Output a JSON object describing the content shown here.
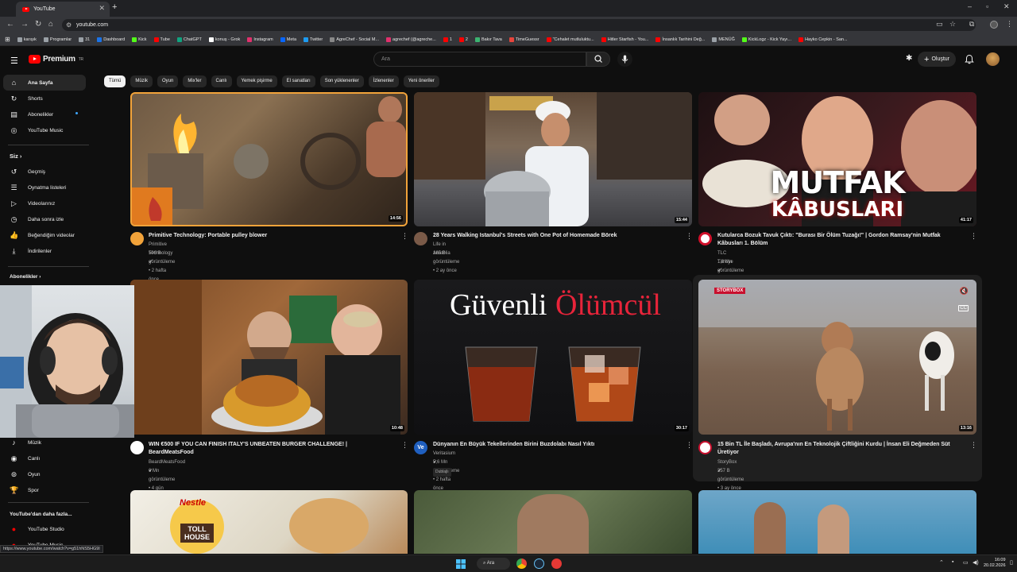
{
  "browser": {
    "tab_title": "YouTube",
    "url": "youtube.com",
    "bookmarks": [
      {
        "label": "karışık",
        "color": "#9aa0a6"
      },
      {
        "label": "Programlar",
        "color": "#9aa0a6"
      },
      {
        "label": "31",
        "color": "#9aa0a6"
      },
      {
        "label": "Dashboard",
        "color": "#1a73e8"
      },
      {
        "label": "Kick",
        "color": "#53fc18"
      },
      {
        "label": "Tube",
        "color": "#ff0000"
      },
      {
        "label": "ChatGPT",
        "color": "#10a37f"
      },
      {
        "label": "konuş - Grok",
        "color": "#ffffff"
      },
      {
        "label": "Instagram",
        "color": "#e1306c"
      },
      {
        "label": "Meta",
        "color": "#0866ff"
      },
      {
        "label": "Twitter",
        "color": "#1d9bf0"
      },
      {
        "label": "AgreChef - Social M...",
        "color": "#888888"
      },
      {
        "label": "agrechef (@agreche...",
        "color": "#e1306c"
      },
      {
        "label": "1",
        "color": "#ff0000"
      },
      {
        "label": "2",
        "color": "#ff0000"
      },
      {
        "label": "Bakır Tava",
        "color": "#3cb371"
      },
      {
        "label": "TimeGuessr",
        "color": "#e8453c"
      },
      {
        "label": "\"Cehalet mutluluktu...",
        "color": "#ff0000"
      },
      {
        "label": "Hitler Starfish - You...",
        "color": "#ff0000"
      },
      {
        "label": "İnsanlık Tarihini Değ...",
        "color": "#ff0000"
      },
      {
        "label": "MENÜĞ",
        "color": "#9aa0a6"
      },
      {
        "label": "KickLogz - Kick Yayı...",
        "color": "#53fc18"
      },
      {
        "label": "Hayko Cepkin - San...",
        "color": "#ff0000"
      }
    ]
  },
  "header": {
    "logo_text": "Premium",
    "logo_sup": "TR",
    "search_placeholder": "Ara",
    "create_label": "Oluştur"
  },
  "sidebar": {
    "main": [
      {
        "label": "Ana Sayfa",
        "icon": "home-icon",
        "glyph": "⌂"
      },
      {
        "label": "Shorts",
        "icon": "shorts-icon",
        "glyph": "↻"
      },
      {
        "label": "Abonelikler",
        "icon": "subscriptions-icon",
        "glyph": "▤"
      },
      {
        "label": "YouTube Music",
        "icon": "music-icon",
        "glyph": "◎"
      }
    ],
    "you_heading": "Siz",
    "you_items": [
      {
        "label": "Geçmiş",
        "icon": "history-icon",
        "glyph": "↺"
      },
      {
        "label": "Oynatma listeleri",
        "icon": "playlists-icon",
        "glyph": "☰"
      },
      {
        "label": "Videolarınız",
        "icon": "your-videos-icon",
        "glyph": "▷"
      },
      {
        "label": "Daha sonra izle",
        "icon": "watch-later-icon",
        "glyph": "◷"
      },
      {
        "label": "Beğendiğim videolar",
        "icon": "liked-icon",
        "glyph": "👍"
      },
      {
        "label": "İndirilenler",
        "icon": "downloads-icon",
        "glyph": "⤓"
      }
    ],
    "subs_heading": "Abonelikler",
    "explore_items": [
      {
        "label": "Müzik",
        "icon": "music-note-icon",
        "glyph": "♪"
      },
      {
        "label": "Canlı",
        "icon": "live-icon",
        "glyph": "◉"
      },
      {
        "label": "Oyun",
        "icon": "gaming-icon",
        "glyph": "⊚"
      },
      {
        "label": "Spor",
        "icon": "sports-icon",
        "glyph": "🏆"
      }
    ],
    "more_heading": "YouTube'dan daha fazla...",
    "more_items": [
      {
        "label": "YouTube Studio",
        "icon": "studio-icon",
        "glyph": "●"
      },
      {
        "label": "YouTube Music",
        "icon": "yt-music-icon",
        "glyph": "●"
      }
    ]
  },
  "chips": [
    "Tümü",
    "Müzik",
    "Oyun",
    "Mix'ler",
    "Canlı",
    "Yemek pişirme",
    "El sanatları",
    "Son yüklenenler",
    "İzlenenler",
    "Yeni öneriler"
  ],
  "videos": [
    {
      "title_1": "Primitive Technology: Portable pulley blower",
      "title_2": "",
      "channel": "Primitive Technology",
      "stats": "596 B görüntüleme • 2 hafta önce",
      "duration": "14:56",
      "avatar_color": "#f2a33a",
      "extra": ""
    },
    {
      "title_1": "28 Years Walking Istanbul's Streets with One Pot of Homemade Börek",
      "title_2": "",
      "channel": "Life in Anatolia",
      "stats": "165 B görüntüleme • 2 ay önce",
      "duration": "15:44",
      "avatar_color": "#7a5a48",
      "extra": ""
    },
    {
      "title_1": "Kutularca Bozuk Tavuk Çıktı: \"Burası Bir Ölüm Tuzağı!\" | Gordon Ramsay'nin Mutfak",
      "title_2": "Kâbusları 1. Bölüm",
      "channel": "TLC Türkiye",
      "stats": "1,6 Mn görüntüleme • 10 gün önce",
      "duration": "41:17",
      "avatar_color": "#ffffff",
      "extra": ""
    },
    {
      "title_1": "WIN €500 IF YOU CAN FINISH ITALY'S UNBEATEN BURGER CHALLENGE! |",
      "title_2": "BeardMeatsFood",
      "channel": "BeardMeatsFood",
      "stats": "6 Mn görüntüleme • 4 gün önce",
      "duration": "10:48",
      "avatar_color": "#ffffff",
      "extra": ""
    },
    {
      "title_1": "Dünyanın En Büyük Tekellerinden Birini Buzdolabı Nasıl Yıktı",
      "title_2": "",
      "channel": "Veritasium",
      "stats": "5,6 Mn görüntüleme • 2 hafta önce",
      "duration": "30:17",
      "avatar_color": "#1f5fbf",
      "extra": "Dublajlı"
    },
    {
      "title_1": "15 Bin TL İle Başladı, Avrupa'nın En Teknolojik Çiftliğini Kurdu | İnsan Eli Değmeden Süt",
      "title_2": "Üretiyor",
      "channel": "StoryBox",
      "stats": "357 B görüntüleme • 3 ay önce",
      "duration": "13:16",
      "avatar_color": "#ffffff",
      "extra": ""
    }
  ],
  "thumb_texts": {
    "mutfak": "MUTFAK",
    "kabuslari": "KÂBUSLARI",
    "guvenli": "Güvenli",
    "olumcul": "Ölümcül",
    "nestle": "Nestle",
    "toll_house": "TOLL HOUSE",
    "storybox": "STORYBOX"
  },
  "status_url": "https://www.youtube.com/watch?v=g51hNS5HG9I",
  "taskbar": {
    "search_label": "Ara",
    "time": "16:09",
    "date": "20.02.2026"
  }
}
